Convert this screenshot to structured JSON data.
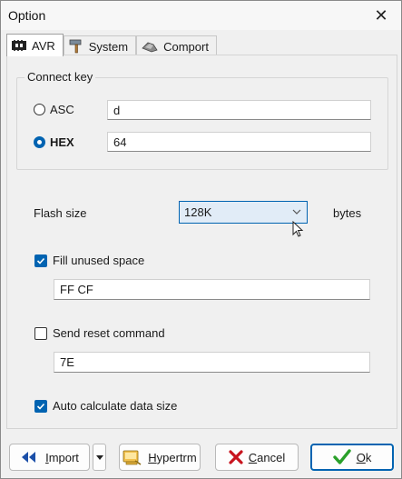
{
  "window": {
    "title": "Option",
    "close_glyph": "✕"
  },
  "tabs": [
    {
      "label": "AVR",
      "icon": "chip-icon",
      "active": true
    },
    {
      "label": "System",
      "icon": "hammer-icon",
      "active": false
    },
    {
      "label": "Comport",
      "icon": "plug-icon",
      "active": false
    }
  ],
  "connect_key": {
    "title": "Connect key",
    "asc": {
      "label": "ASC",
      "value": "d",
      "selected": false
    },
    "hex": {
      "label": "HEX",
      "value": "64",
      "selected": true
    }
  },
  "flash_size": {
    "label": "Flash size",
    "value": "128K",
    "unit": "bytes"
  },
  "fill_unused": {
    "label": "Fill unused space",
    "checked": true,
    "value": "FF CF"
  },
  "send_reset": {
    "label": "Send reset command",
    "checked": false,
    "value": "7E"
  },
  "auto_calc": {
    "label": "Auto calculate data size",
    "checked": true
  },
  "buttons": {
    "import": {
      "first": "I",
      "rest": "mport"
    },
    "hypertrm": {
      "first": "H",
      "rest": "ypertrm"
    },
    "cancel": {
      "first": "C",
      "rest": "ancel"
    },
    "ok": {
      "first": "O",
      "rest": "k"
    }
  },
  "colors": {
    "accent": "#0063b1",
    "cancel_red": "#c8141e",
    "ok_green": "#2aa02a"
  }
}
